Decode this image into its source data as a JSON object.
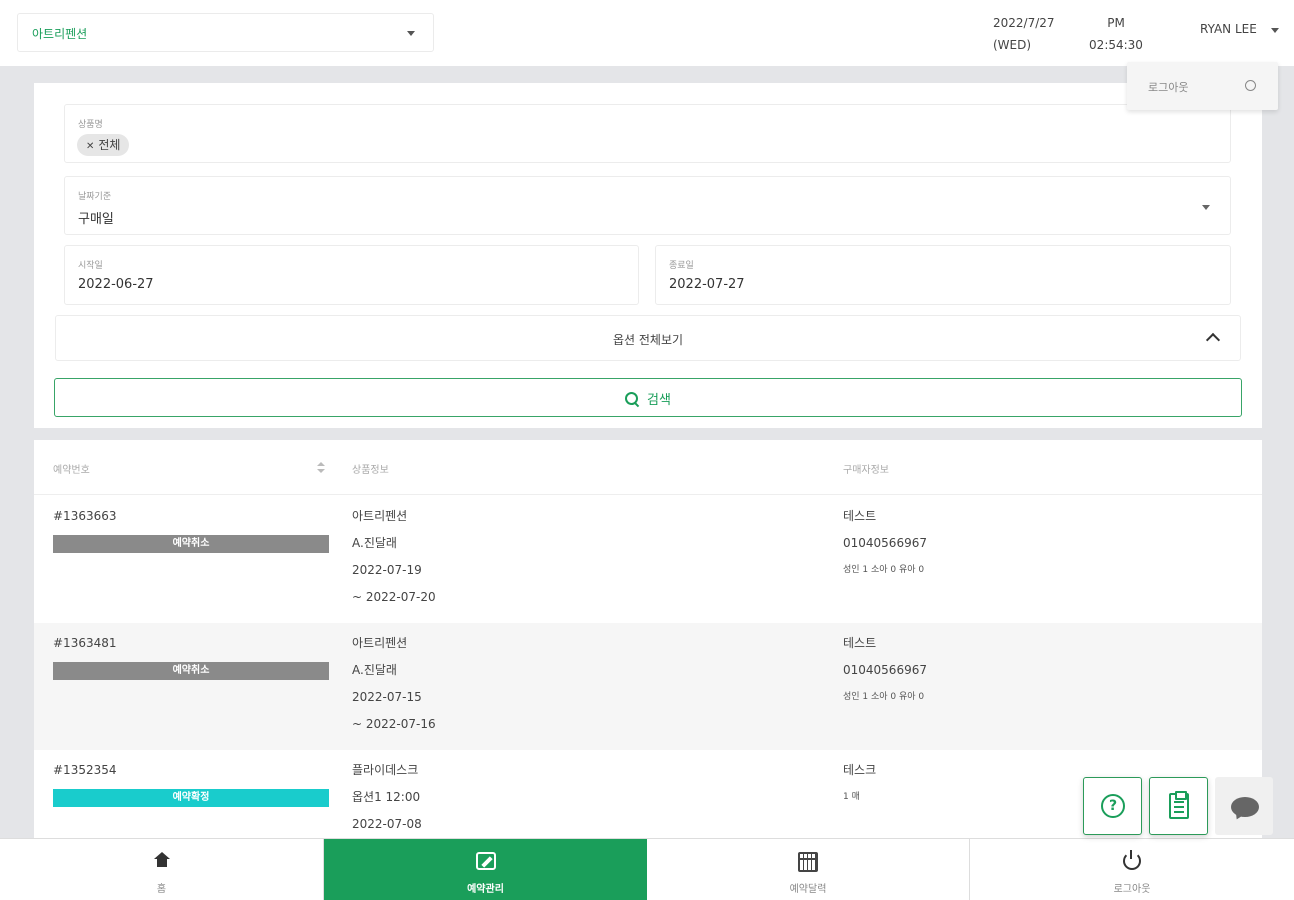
{
  "header": {
    "store_select": "아트리펜션",
    "date": "2022/7/27",
    "weekday": "(WED)",
    "ampm": "PM",
    "time": "02:54:30",
    "user": "RYAN LEE"
  },
  "user_menu": {
    "logout": "로그아웃"
  },
  "filters": {
    "product_label": "상품명",
    "product_chip": "전체",
    "date_basis_label": "날짜기준",
    "date_basis_value": "구매일",
    "start_label": "시작일",
    "start_value": "2022-06-27",
    "end_label": "종료일",
    "end_value": "2022-07-27",
    "options_toggle": "옵션 전체보기",
    "search_button": "검색"
  },
  "table": {
    "headers": [
      "예약번호",
      "상품정보",
      "구매자정보"
    ],
    "rows": [
      {
        "id": "#1363663",
        "status": "예약취소",
        "product": "아트리펜션",
        "option": "A.진달래",
        "date_from": "2022-07-19",
        "date_to": "~ 2022-07-20",
        "buyer": "테스트",
        "phone": "01040566967",
        "guests": "성인 1 소아 0 유아 0"
      },
      {
        "id": "#1363481",
        "status": "예약취소",
        "product": "아트리펜션",
        "option": "A.진달래",
        "date_from": "2022-07-15",
        "date_to": "~ 2022-07-16",
        "buyer": "테스트",
        "phone": "01040566967",
        "guests": "성인 1 소아 0 유아 0"
      },
      {
        "id": "#1352354",
        "status": "예약확정",
        "product": "플라이데스크",
        "option": "옵션1 12:00",
        "date_from": "2022-07-08",
        "buyer": "테스크",
        "qty": "1 매"
      }
    ]
  },
  "bottom_nav": [
    "홈",
    "예약관리",
    "예약달력",
    "로그아웃"
  ],
  "colors": {
    "accent": "#1a9e5a",
    "status_cancel": "#8a8a8a",
    "status_confirm": "#19cccc"
  }
}
